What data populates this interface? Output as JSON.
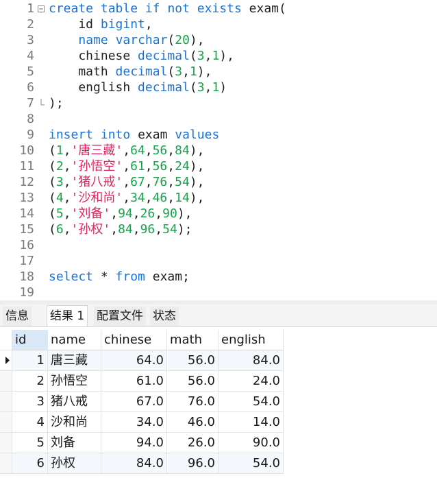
{
  "editor": {
    "lines": [
      {
        "n": "1",
        "parts": [
          [
            "kw",
            "create"
          ],
          [
            "t",
            " "
          ],
          [
            "kw",
            "table"
          ],
          [
            "t",
            " "
          ],
          [
            "kw",
            "if"
          ],
          [
            "t",
            " "
          ],
          [
            "kw",
            "not"
          ],
          [
            "t",
            " "
          ],
          [
            "kw",
            "exists"
          ],
          [
            "t",
            " exam("
          ]
        ]
      },
      {
        "n": "2",
        "parts": [
          [
            "t",
            "    id "
          ],
          [
            "kw",
            "bigint"
          ],
          [
            "t",
            ","
          ]
        ]
      },
      {
        "n": "3",
        "parts": [
          [
            "t",
            "    "
          ],
          [
            "kw",
            "name"
          ],
          [
            "t",
            " "
          ],
          [
            "kw",
            "varchar"
          ],
          [
            "t",
            "("
          ],
          [
            "num",
            "20"
          ],
          [
            "t",
            "),"
          ]
        ]
      },
      {
        "n": "4",
        "parts": [
          [
            "t",
            "    chinese "
          ],
          [
            "kw",
            "decimal"
          ],
          [
            "t",
            "("
          ],
          [
            "num",
            "3"
          ],
          [
            "t",
            ","
          ],
          [
            "num",
            "1"
          ],
          [
            "t",
            "),"
          ]
        ]
      },
      {
        "n": "5",
        "parts": [
          [
            "t",
            "    math "
          ],
          [
            "kw",
            "decimal"
          ],
          [
            "t",
            "("
          ],
          [
            "num",
            "3"
          ],
          [
            "t",
            ","
          ],
          [
            "num",
            "1"
          ],
          [
            "t",
            "),"
          ]
        ]
      },
      {
        "n": "6",
        "parts": [
          [
            "t",
            "    english "
          ],
          [
            "kw",
            "decimal"
          ],
          [
            "t",
            "("
          ],
          [
            "num",
            "3"
          ],
          [
            "t",
            ","
          ],
          [
            "num",
            "1"
          ],
          [
            "t",
            ")"
          ]
        ]
      },
      {
        "n": "7",
        "parts": [
          [
            "t",
            ");"
          ]
        ]
      },
      {
        "n": "8",
        "parts": []
      },
      {
        "n": "9",
        "parts": [
          [
            "kw",
            "insert"
          ],
          [
            "t",
            " "
          ],
          [
            "kw",
            "into"
          ],
          [
            "t",
            " exam "
          ],
          [
            "kw",
            "values"
          ]
        ]
      },
      {
        "n": "10",
        "parts": [
          [
            "t",
            "("
          ],
          [
            "num",
            "1"
          ],
          [
            "t",
            ","
          ],
          [
            "str",
            "'唐三藏'"
          ],
          [
            "t",
            ","
          ],
          [
            "num",
            "64"
          ],
          [
            "t",
            ","
          ],
          [
            "num",
            "56"
          ],
          [
            "t",
            ","
          ],
          [
            "num",
            "84"
          ],
          [
            "t",
            "),"
          ]
        ]
      },
      {
        "n": "11",
        "parts": [
          [
            "t",
            "("
          ],
          [
            "num",
            "2"
          ],
          [
            "t",
            ","
          ],
          [
            "str",
            "'孙悟空'"
          ],
          [
            "t",
            ","
          ],
          [
            "num",
            "61"
          ],
          [
            "t",
            ","
          ],
          [
            "num",
            "56"
          ],
          [
            "t",
            ","
          ],
          [
            "num",
            "24"
          ],
          [
            "t",
            "),"
          ]
        ]
      },
      {
        "n": "12",
        "parts": [
          [
            "t",
            "("
          ],
          [
            "num",
            "3"
          ],
          [
            "t",
            ","
          ],
          [
            "str",
            "'猪八戒'"
          ],
          [
            "t",
            ","
          ],
          [
            "num",
            "67"
          ],
          [
            "t",
            ","
          ],
          [
            "num",
            "76"
          ],
          [
            "t",
            ","
          ],
          [
            "num",
            "54"
          ],
          [
            "t",
            "),"
          ]
        ]
      },
      {
        "n": "13",
        "parts": [
          [
            "t",
            "("
          ],
          [
            "num",
            "4"
          ],
          [
            "t",
            ","
          ],
          [
            "str",
            "'沙和尚'"
          ],
          [
            "t",
            ","
          ],
          [
            "num",
            "34"
          ],
          [
            "t",
            ","
          ],
          [
            "num",
            "46"
          ],
          [
            "t",
            ","
          ],
          [
            "num",
            "14"
          ],
          [
            "t",
            "),"
          ]
        ]
      },
      {
        "n": "14",
        "parts": [
          [
            "t",
            "("
          ],
          [
            "num",
            "5"
          ],
          [
            "t",
            ","
          ],
          [
            "str",
            "'刘备'"
          ],
          [
            "t",
            ","
          ],
          [
            "num",
            "94"
          ],
          [
            "t",
            ","
          ],
          [
            "num",
            "26"
          ],
          [
            "t",
            ","
          ],
          [
            "num",
            "90"
          ],
          [
            "t",
            "),"
          ]
        ]
      },
      {
        "n": "15",
        "parts": [
          [
            "t",
            "("
          ],
          [
            "num",
            "6"
          ],
          [
            "t",
            ","
          ],
          [
            "str",
            "'孙权'"
          ],
          [
            "t",
            ","
          ],
          [
            "num",
            "84"
          ],
          [
            "t",
            ","
          ],
          [
            "num",
            "96"
          ],
          [
            "t",
            ","
          ],
          [
            "num",
            "54"
          ],
          [
            "t",
            ");"
          ]
        ]
      },
      {
        "n": "16",
        "parts": []
      },
      {
        "n": "17",
        "parts": []
      },
      {
        "n": "18",
        "parts": [
          [
            "kw",
            "select"
          ],
          [
            "t",
            " * "
          ],
          [
            "kw",
            "from"
          ],
          [
            "t",
            " exam;"
          ]
        ]
      },
      {
        "n": "19",
        "parts": []
      }
    ]
  },
  "tabs": {
    "info": "信息",
    "result1": "结果 1",
    "profile": "配置文件",
    "status": "状态"
  },
  "grid": {
    "columns": [
      "id",
      "name",
      "chinese",
      "math",
      "english"
    ],
    "rows": [
      [
        "1",
        "唐三藏",
        "64.0",
        "56.0",
        "84.0"
      ],
      [
        "2",
        "孙悟空",
        "61.0",
        "56.0",
        "24.0"
      ],
      [
        "3",
        "猪八戒",
        "67.0",
        "76.0",
        "54.0"
      ],
      [
        "4",
        "沙和尚",
        "34.0",
        "46.0",
        "14.0"
      ],
      [
        "5",
        "刘备",
        "94.0",
        "26.0",
        "90.0"
      ],
      [
        "6",
        "孙权",
        "84.0",
        "96.0",
        "54.0"
      ]
    ]
  }
}
